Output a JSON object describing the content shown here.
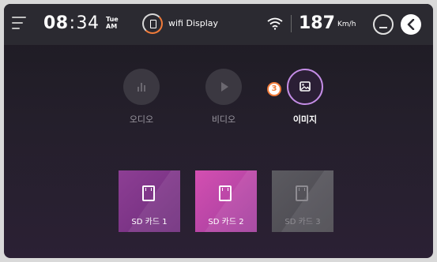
{
  "status_bar": {
    "time_hour": "08",
    "time_separator": ":",
    "time_minute": "34",
    "day": "Tue",
    "ampm": "AM",
    "source_label": "wifi Display",
    "speed": "187",
    "speed_unit": "Km/h"
  },
  "media_tabs": [
    {
      "label": "오디오",
      "icon": "equalizer-icon",
      "active": false
    },
    {
      "label": "비디오",
      "icon": "play-icon",
      "active": false
    },
    {
      "label": "이미지",
      "icon": "image-icon",
      "active": true
    }
  ],
  "image_badge": "3",
  "storage_cards": [
    {
      "label": "SD 카드 1",
      "icon": "sd-card-icon",
      "enabled": true
    },
    {
      "label": "SD 카드 2",
      "icon": "sd-card-icon",
      "enabled": true
    },
    {
      "label": "SD 카드 3",
      "icon": "sd-card-icon",
      "enabled": false
    }
  ],
  "colors": {
    "accent_orange": "#f07b3a",
    "active_ring": "#c48de6",
    "card1": "#8d3e94",
    "card2": "#d44fb1",
    "card3_disabled": "#5b5a60"
  }
}
